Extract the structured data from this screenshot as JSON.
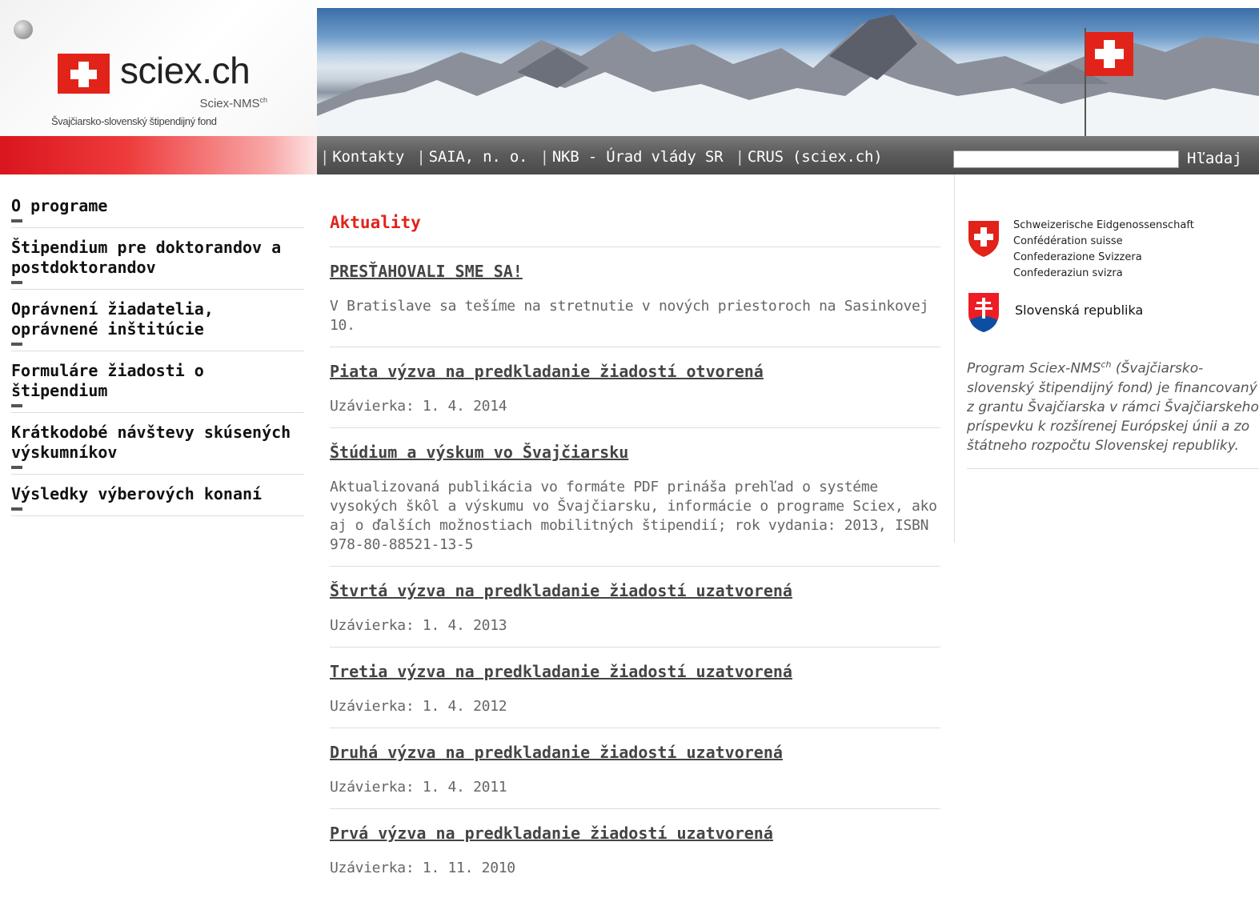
{
  "header": {
    "logo_text": "sciex.ch",
    "logo_sub1": "Sciex-NMS",
    "logo_sub1_sup": "ch",
    "logo_sub2": "Švajčiarsko-slovenský štipendijný fond"
  },
  "nav": {
    "links": [
      "Kontakty",
      "SAIA, n. o.",
      "NKB - Úrad vlády SR",
      "CRUS (sciex.ch)"
    ],
    "search_value": "",
    "search_button": "Hľadaj"
  },
  "sidebar": {
    "items": [
      {
        "label": "O programe"
      },
      {
        "label": "Štipendium pre doktorandov a postdoktorandov"
      },
      {
        "label": "Oprávnení žiadatelia, oprávnené inštitúcie"
      },
      {
        "label": "Formuláre žiadosti o štipendium"
      },
      {
        "label": "Krátkodobé návštevy skúsených výskumníkov"
      },
      {
        "label": "Výsledky výberových konaní"
      }
    ]
  },
  "main": {
    "title": "Aktuality",
    "news": [
      {
        "title": "PRESŤAHOVALI SME SA!",
        "body": "V Bratislave sa tešíme na stretnutie v nových priestoroch na Sasinkovej 10."
      },
      {
        "title": "Piata výzva na predkladanie žiadostí otvorená",
        "body": "Uzávierka: 1. 4. 2014"
      },
      {
        "title": "Štúdium a výskum vo Švajčiarsku",
        "body": "Aktualizovaná publikácia vo formáte PDF prináša prehľad o systéme vysokých škôl a výskumu vo Švajčiarsku, informácie o programe Sciex, ako aj o ďalších možnostiach mobilitných štipendií; rok vydania: 2013, ISBN 978-80-88521-13-5"
      },
      {
        "title": "Štvrtá výzva na predkladanie žiadostí uzatvorená",
        "body": "Uzávierka: 1. 4. 2013"
      },
      {
        "title": "Tretia výzva na predkladanie žiadostí uzatvorená",
        "body": "Uzávierka: 1. 4. 2012"
      },
      {
        "title": "Druhá výzva na predkladanie žiadostí uzatvorená",
        "body": "Uzávierka: 1. 4. 2011"
      },
      {
        "title": "Prvá výzva na predkladanie žiadostí uzatvorená",
        "body": "Uzávierka: 1. 11. 2010"
      }
    ]
  },
  "right": {
    "ch_lines": [
      "Schweizerische Eidgenossenschaft",
      "Confédération suisse",
      "Confederazione Svizzera",
      "Confederaziun svizra"
    ],
    "sk_text": "Slovenská republika",
    "desc_prefix": "Program Sciex-NMS",
    "desc_sup": "ch",
    "desc_rest": " (Švajčiarsko-slovenský štipendijný fond) je financovaný z grantu Švajčiarska v rámci Švajčiarskeho príspevku k rozšírenej Európskej únii a zo štátneho rozpočtu Slovenskej republiky."
  },
  "colors": {
    "accent_red": "#e2231a",
    "nav_gray": "#555555"
  }
}
